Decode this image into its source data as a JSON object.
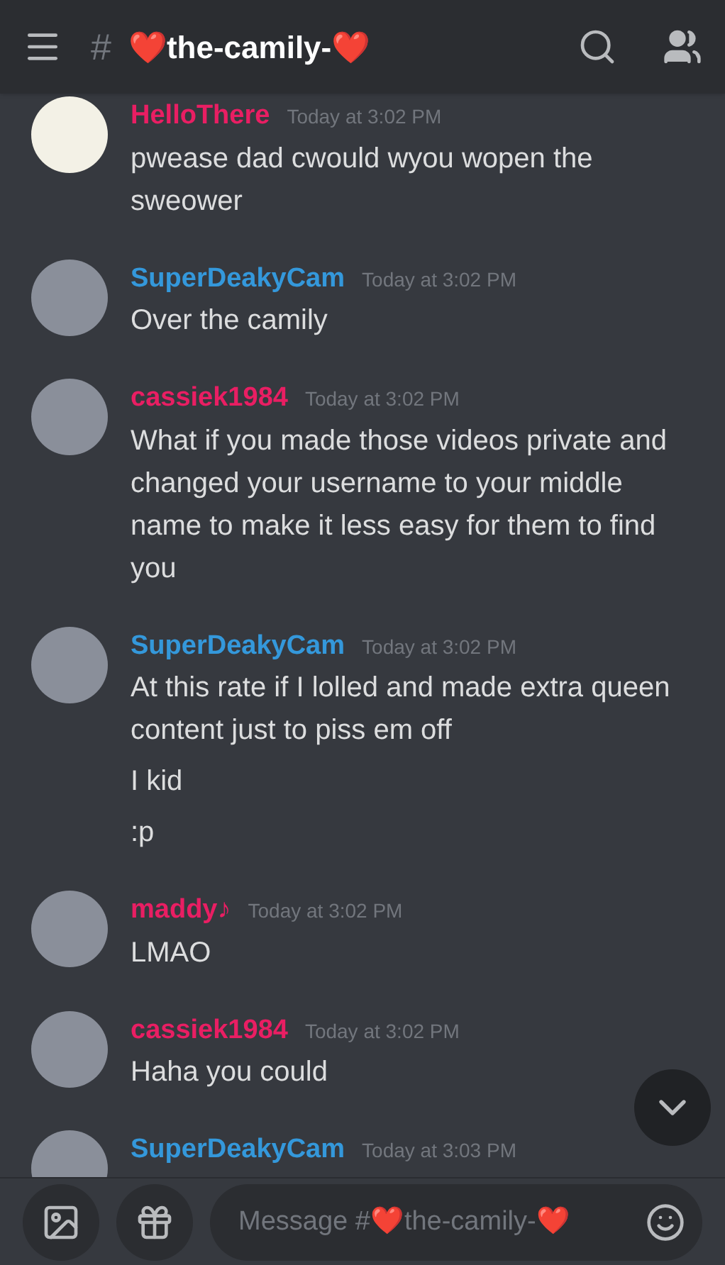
{
  "header": {
    "hash": "#",
    "channel_name": "❤️the-camily-❤️"
  },
  "messages": [
    {
      "author": "HelloThere",
      "color": "#e91e63",
      "time": "Today at 3:02 PM",
      "lines": [
        "pwease dad cwould wyou wopen the sweower"
      ]
    },
    {
      "author": "SuperDeakyCam",
      "color": "#3498db",
      "time": "Today at 3:02 PM",
      "lines": [
        "Over the camily"
      ]
    },
    {
      "author": "cassiek1984",
      "color": "#e91e63",
      "time": "Today at 3:02 PM",
      "lines": [
        "What if you made those videos private and changed your username to your middle name to make it less easy for them to find you"
      ]
    },
    {
      "author": "SuperDeakyCam",
      "color": "#3498db",
      "time": "Today at 3:02 PM",
      "lines": [
        "At this rate if I lolled and made extra queen content just to piss em off",
        "I kid",
        ":p"
      ]
    },
    {
      "author": "maddy♪",
      "color": "#e91e63",
      "time": "Today at 3:02 PM",
      "lines": [
        "LMAO"
      ]
    },
    {
      "author": "cassiek1984",
      "color": "#e91e63",
      "time": "Today at 3:02 PM",
      "lines": [
        "Haha you could"
      ]
    },
    {
      "author": "SuperDeakyCam",
      "color": "#3498db",
      "time": "Today at 3:03 PM"
    }
  ],
  "composer": {
    "placeholder": "Message #❤️the-camily-❤️"
  }
}
